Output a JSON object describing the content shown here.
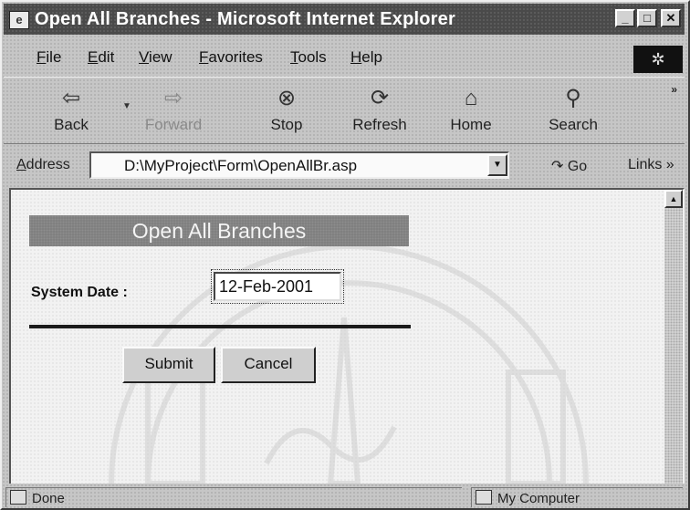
{
  "window": {
    "title": "Open All Branches - Microsoft Internet Explorer",
    "controls": {
      "minimize": "_",
      "maximize": "□",
      "close": "✕"
    }
  },
  "menu": {
    "items": [
      "File",
      "Edit",
      "View",
      "Favorites",
      "Tools",
      "Help"
    ]
  },
  "toolbar": {
    "buttons": [
      {
        "label": "Back",
        "icon": "back-arrow-icon",
        "glyph": "⇦"
      },
      {
        "label": "Forward",
        "icon": "forward-arrow-icon",
        "glyph": "⇨"
      },
      {
        "label": "Stop",
        "icon": "stop-icon",
        "glyph": "⊗"
      },
      {
        "label": "Refresh",
        "icon": "refresh-icon",
        "glyph": "⟳"
      },
      {
        "label": "Home",
        "icon": "home-icon",
        "glyph": "⌂"
      },
      {
        "label": "Search",
        "icon": "search-icon",
        "glyph": "⚲"
      }
    ],
    "more": "»"
  },
  "address": {
    "label": "Address",
    "url": "D:\\MyProject\\Form\\OpenAllBr.asp",
    "go_label": "Go",
    "links_label": "Links »"
  },
  "form": {
    "title": "Open All Branches",
    "system_date_label": "System Date :",
    "system_date_value": "12-Feb-2001",
    "submit_label": "Submit",
    "cancel_label": "Cancel"
  },
  "status": {
    "left": "Done",
    "right": "My Computer"
  }
}
